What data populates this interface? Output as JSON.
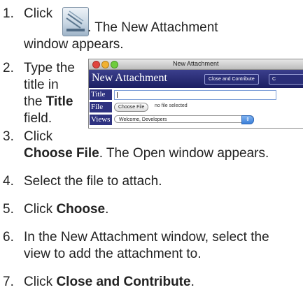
{
  "steps": [
    {
      "num": "1.",
      "lines": [
        "Click",
        ". The New Attachment",
        "window appears."
      ]
    },
    {
      "num": "2.",
      "lines": [
        "Type the",
        "title in",
        "the",
        "Title",
        "field."
      ]
    },
    {
      "num": "3.",
      "lines": [
        "Click",
        "Choose File",
        ". The Open window appears."
      ]
    },
    {
      "num": "4.",
      "lines": [
        "Select the file to attach."
      ]
    },
    {
      "num": "5.",
      "lines": [
        "Click ",
        "Choose",
        "."
      ]
    },
    {
      "num": "6.",
      "lines": [
        "In the New Attachment window, select the",
        "view to add the attachment to."
      ]
    },
    {
      "num": "7.",
      "lines": [
        "Click ",
        "Close and Contribute",
        "."
      ]
    }
  ],
  "window": {
    "title": "New Attachment",
    "header_title": "New Attachment",
    "close_contribute_label": "Close and Contribute",
    "second_button_label": "C",
    "title_label": "Title",
    "file_label": "File",
    "choose_file_label": "Choose File",
    "no_file_text": "no file selected",
    "views_label": "Views",
    "views_value": "Welcome, Developers"
  },
  "icons": {
    "attach_icon": "new-attachment-icon"
  }
}
